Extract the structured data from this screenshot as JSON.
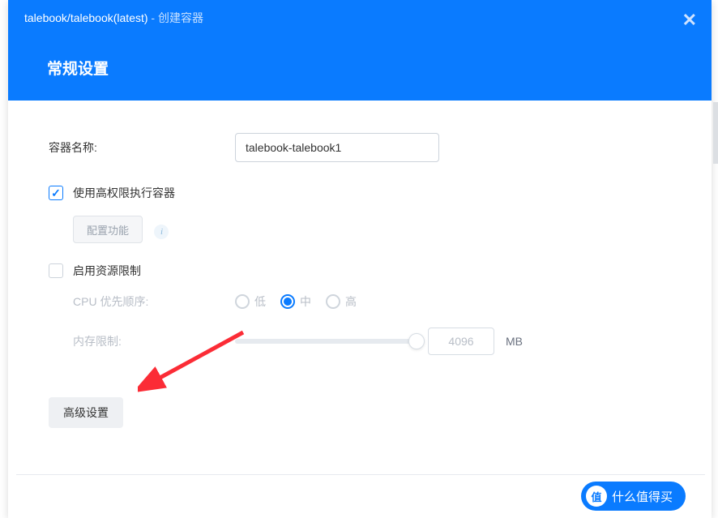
{
  "header": {
    "breadcrumb_main": "talebook/talebook(latest)",
    "breadcrumb_sep": " - ",
    "breadcrumb_action": "创建容器",
    "section_title": "常规设置"
  },
  "form": {
    "container_name_label": "容器名称:",
    "container_name_value": "talebook-talebook1",
    "privileged_label": "使用高权限执行容器",
    "config_capabilities_btn": "配置功能",
    "resource_limit_label": "启用资源限制",
    "cpu_priority_label": "CPU 优先顺序:",
    "cpu_options": {
      "low": "低",
      "mid": "中",
      "high": "高"
    },
    "memory_limit_label": "内存限制:",
    "memory_value": "4096",
    "memory_unit": "MB",
    "advanced_btn": "高级设置"
  },
  "footer": {
    "next_badge": "值",
    "next_text": "什么值得买"
  },
  "colors": {
    "primary": "#0a7bff",
    "arrow": "#fb2c36"
  }
}
